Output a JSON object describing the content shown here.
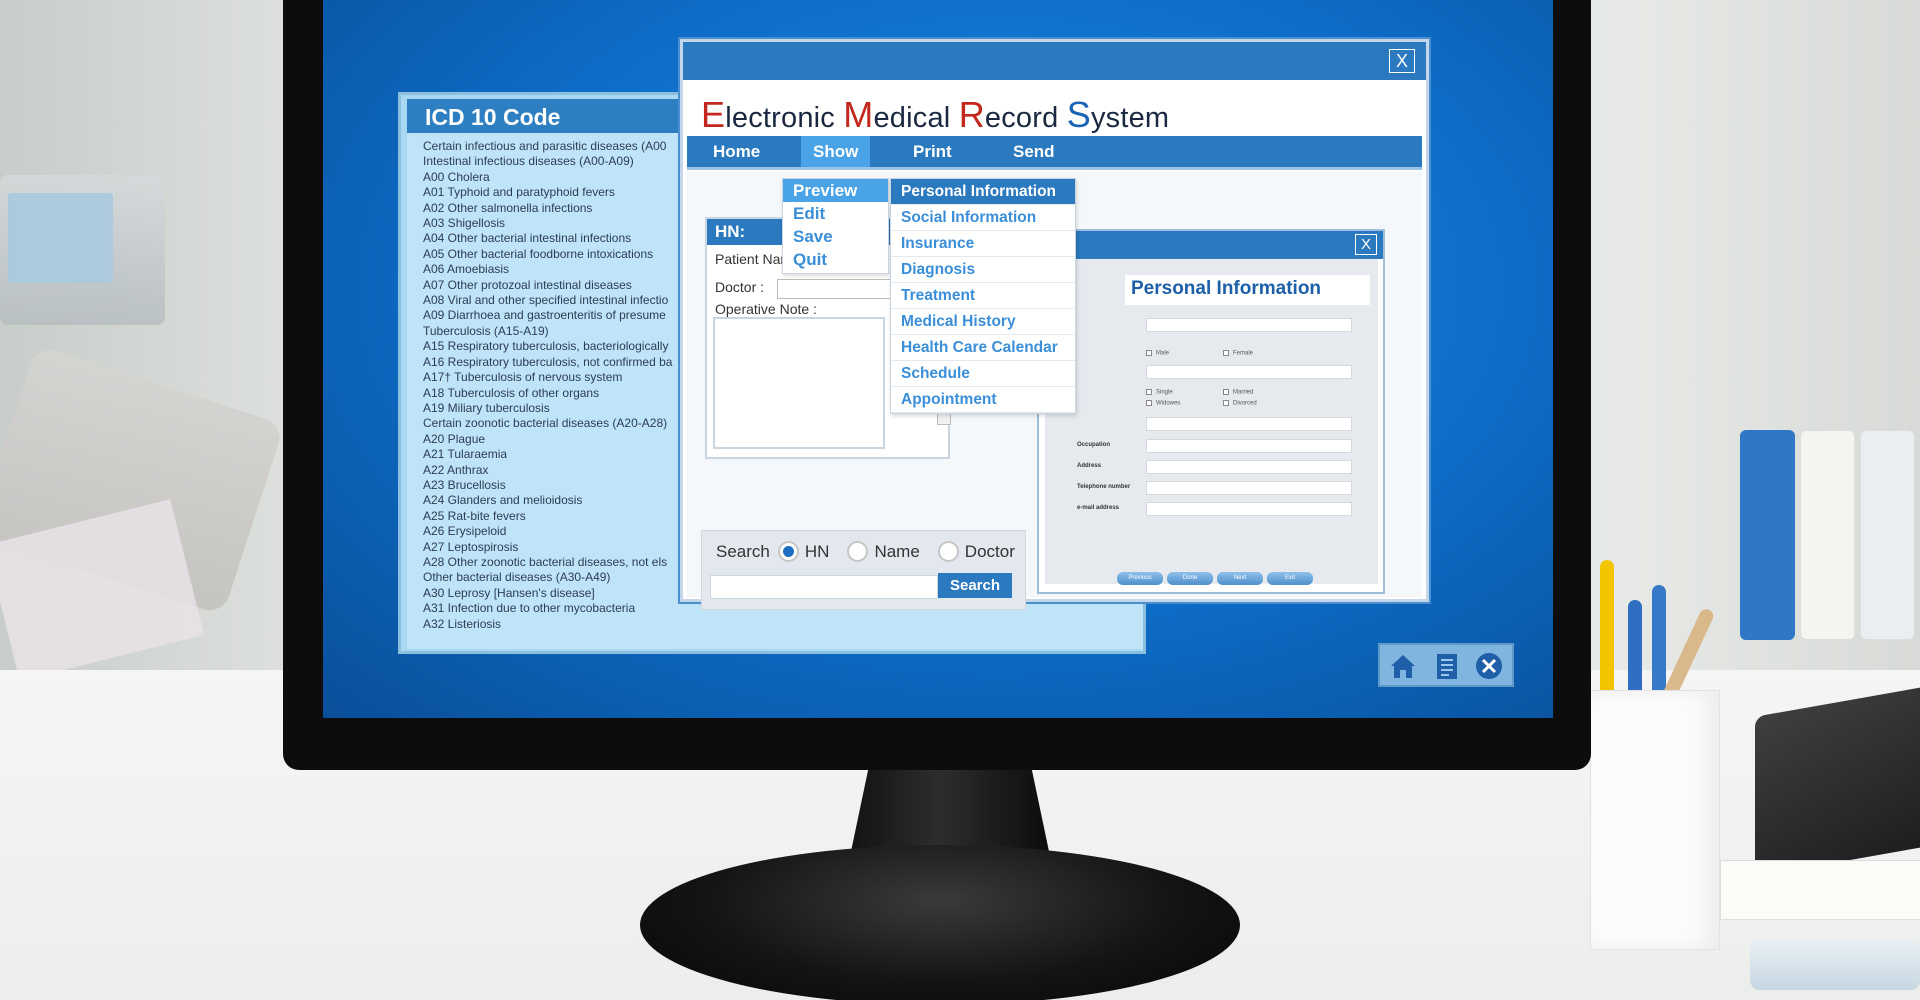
{
  "icd_window": {
    "title": "ICD 10 Code",
    "items": [
      "Certain infectious and parasitic diseases (A00",
      "Intestinal infectious diseases (A00-A09)",
      "A00 Cholera",
      "A01 Typhoid and paratyphoid fevers",
      "A02 Other salmonella infections",
      "A03 Shigellosis",
      "A04 Other bacterial intestinal infections",
      "A05 Other bacterial foodborne intoxications",
      "A06 Amoebiasis",
      "A07 Other protozoal intestinal diseases",
      "A08 Viral and other specified intestinal infectio",
      "A09 Diarrhoea and gastroenteritis of presume",
      "Tuberculosis (A15-A19)",
      "A15 Respiratory tuberculosis, bacteriologically",
      "A16 Respiratory tuberculosis, not confirmed ba",
      "A17† Tuberculosis of nervous system",
      "A18 Tuberculosis of other organs",
      "A19 Miliary tuberculosis",
      "Certain zoonotic bacterial diseases (A20-A28)",
      "A20 Plague",
      "A21 Tularaemia",
      "A22 Anthrax",
      "A23 Brucellosis",
      "A24 Glanders and melioidosis",
      "A25 Rat-bite fevers",
      "A26 Erysipeloid",
      "A27 Leptospirosis",
      "A28 Other zoonotic bacterial diseases, not els",
      "Other bacterial diseases (A30-A49)",
      "A30 Leprosy [Hansen's disease]",
      "A31 Infection due to other mycobacteria",
      "A32 Listeriosis"
    ]
  },
  "emr": {
    "title_parts": {
      "e_cap": "E",
      "e_rest": "lectronic ",
      "m_cap": "M",
      "m_rest": "edical ",
      "r_cap": "R",
      "r_rest": "ecord ",
      "s_cap": "S",
      "s_rest": "ystem"
    },
    "close_label": "X",
    "nav": {
      "home": "Home",
      "show": "Show",
      "print": "Print",
      "send": "Send"
    },
    "show_menu": [
      "Preview",
      "Edit",
      "Save",
      "Quit"
    ],
    "submenu": [
      "Personal Information",
      "Social Information",
      "Insurance",
      "Diagnosis",
      "Treatment",
      "Medical History",
      "Health Care Calendar",
      "Schedule",
      "Appointment"
    ],
    "hn_panel": {
      "header": "HN:",
      "patient_name_label": "Patient Name",
      "doctor_label": "Doctor :",
      "operative_note_label": "Operative Note :"
    },
    "search": {
      "label": "Search",
      "options": [
        "HN",
        "Name",
        "Doctor"
      ],
      "selected": "HN",
      "button": "Search"
    },
    "personal_info": {
      "close_label": "X",
      "title": "Personal Information",
      "gender_options": [
        "Male",
        "Female"
      ],
      "marital_options": [
        "Single",
        "Married",
        "Widowes",
        "Divorced"
      ],
      "field_labels": [
        "Occupation",
        "Address",
        "Telephone number",
        "e-mail address"
      ],
      "buttons": [
        "Previous",
        "Done",
        "Next",
        "Exit"
      ]
    }
  },
  "colors": {
    "accent_blue": "#2b79bf",
    "highlight_blue": "#4aa3e6",
    "title_red": "#c2281e",
    "title_blue": "#1b63b4"
  },
  "taskbar_icons": [
    "home-icon",
    "document-icon",
    "close-circle-icon"
  ]
}
